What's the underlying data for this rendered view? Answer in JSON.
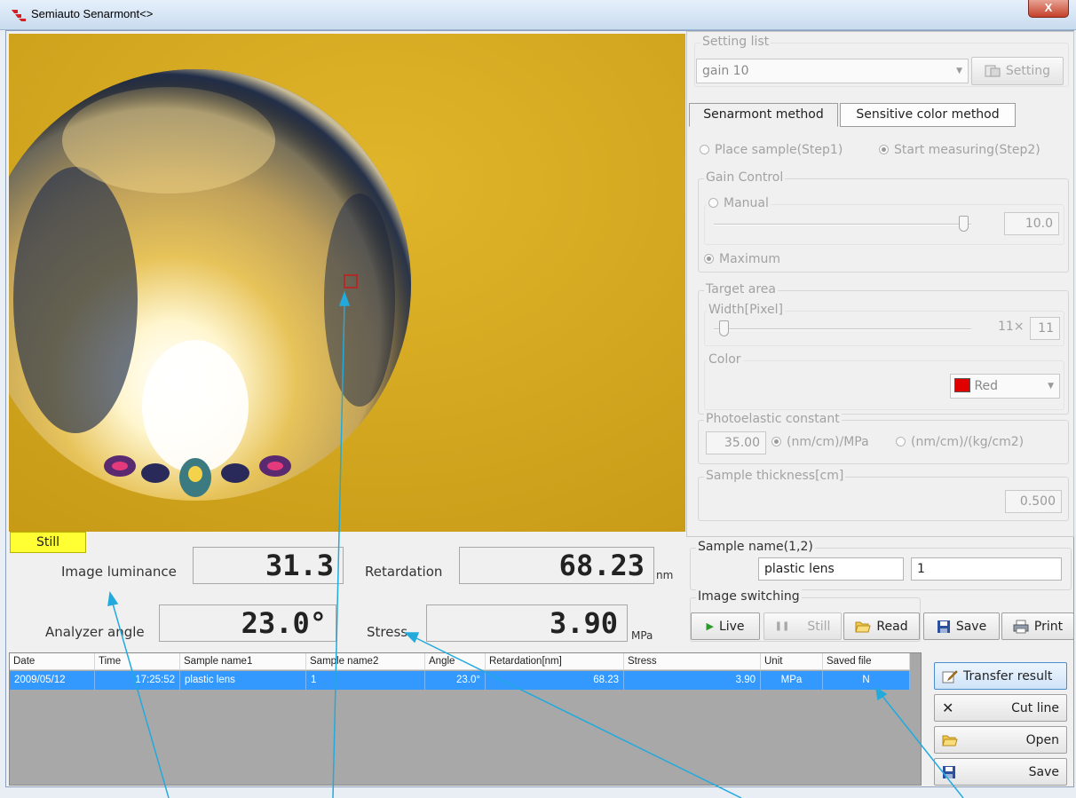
{
  "window": {
    "title": "Semiauto Senarmont<>",
    "close_label": "X"
  },
  "image": {
    "mode_badge": "Still",
    "marker_color": "#c81a1a"
  },
  "measurements": {
    "image_luminance": {
      "label": "Image luminance",
      "value": "31.3"
    },
    "retardation": {
      "label": "Retardation",
      "value": "68.23",
      "unit": "nm"
    },
    "analyzer_angle": {
      "label": "Analyzer angle",
      "value": "23.0°"
    },
    "stress": {
      "label": "Stress",
      "value": "3.90",
      "unit": "MPa"
    }
  },
  "settings": {
    "setting_list": {
      "label": "Setting list",
      "value": "gain 10"
    },
    "setting_button": "Setting",
    "tabs": [
      "Senarmont method",
      "Sensitive color method"
    ],
    "steps": [
      "Place sample(Step1)",
      "Start measuring(Step2)"
    ],
    "gain_control": {
      "label": "Gain Control",
      "manual": "Manual",
      "value": "10.0",
      "maximum": "Maximum"
    },
    "target_area": {
      "label": "Target area",
      "width_label": "Width[Pixel]",
      "width_text": "11×",
      "width_value": "11",
      "color_label": "Color",
      "color_value": "Red",
      "color_swatch": "#e00000"
    },
    "photoelastic": {
      "label": "Photoelastic constant",
      "value": "35.00",
      "unit1": "(nm/cm)/MPa",
      "unit2": "(nm/cm)/(kg/cm2)"
    },
    "sample_thickness": {
      "label": "Sample thickness[cm]",
      "value": "0.500"
    }
  },
  "sample_name": {
    "label": "Sample name(1,2)",
    "name1": "plastic lens",
    "name2": "1"
  },
  "image_switching": {
    "label": "Image switching",
    "live": "Live",
    "still": "Still",
    "read": "Read"
  },
  "actions": {
    "save": "Save",
    "print": "Print"
  },
  "results_table": {
    "columns": [
      "Date",
      "Time",
      "Sample name1",
      "Sample name2",
      "Angle",
      "Retardation[nm]",
      "Stress",
      "Unit",
      "Saved file"
    ],
    "rows": [
      [
        "2009/05/12",
        "17:25:52",
        "plastic lens",
        "1",
        "23.0°",
        "68.23",
        "3.90",
        "MPa",
        "N"
      ]
    ]
  },
  "side_buttons": [
    "Transfer result",
    "Cut line",
    "Open",
    "Save"
  ],
  "annotation_color": "#22aadd"
}
